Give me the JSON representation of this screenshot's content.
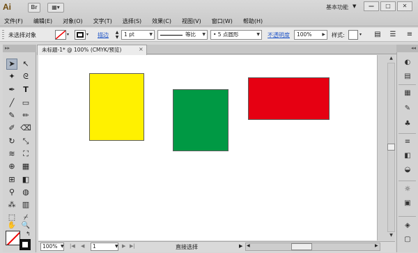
{
  "app": {
    "logo": "Ai",
    "bridge": "Br"
  },
  "workspace": "基本功能",
  "window_buttons": {
    "minimize": "—",
    "maximize": "□",
    "close": "✕"
  },
  "menu": [
    "文件(F)",
    "编辑(E)",
    "对象(O)",
    "文字(T)",
    "选择(S)",
    "效果(C)",
    "视图(V)",
    "窗口(W)",
    "帮助(H)"
  ],
  "control_bar": {
    "selection_status": "未选择对象",
    "stroke_link": "描边",
    "stroke_weight": "1 pt",
    "stroke_profile": "等比",
    "brush": "• 5 点圆形",
    "opacity_link": "不透明度",
    "opacity_value": "100%",
    "style_label": "样式:"
  },
  "document": {
    "tab_title": "未标题-1* @ 100% (CMYK/预览)",
    "tab_close": "×"
  },
  "artwork": [
    {
      "name": "yellow-rect",
      "color": "#FFF100"
    },
    {
      "name": "green-rect",
      "color": "#009944"
    },
    {
      "name": "red-rect",
      "color": "#E60012"
    }
  ],
  "status_bar": {
    "zoom": "100%",
    "page": "1",
    "tool_status": "直接选择"
  },
  "colors": {
    "fill": "none",
    "stroke": "#000000",
    "accent_link": "#2156c8"
  },
  "tools": [
    "selection-tool-icon",
    "direct-selection-tool-icon",
    "magic-wand-tool-icon",
    "lasso-tool-icon",
    "pen-tool-icon",
    "type-tool-icon",
    "line-segment-tool-icon",
    "rectangle-tool-icon",
    "paintbrush-tool-icon",
    "pencil-tool-icon",
    "blob-brush-tool-icon",
    "eraser-tool-icon",
    "rotate-tool-icon",
    "scale-tool-icon",
    "width-tool-icon",
    "free-transform-tool-icon",
    "shape-builder-tool-icon",
    "perspective-grid-tool-icon",
    "mesh-tool-icon",
    "gradient-tool-icon",
    "eyedropper-tool-icon",
    "blend-tool-icon",
    "symbol-sprayer-tool-icon",
    "column-graph-tool-icon",
    "artboard-tool-icon",
    "slice-tool-icon",
    "hand-tool-icon",
    "zoom-tool-icon"
  ],
  "dock_panels": [
    "color-panel-icon",
    "color-guide-panel-icon",
    "swatches-panel-icon",
    "brushes-panel-icon",
    "symbols-panel-icon",
    "stroke-panel-icon",
    "gradient-panel-icon",
    "transparency-panel-icon",
    "appearance-panel-icon",
    "graphic-styles-panel-icon",
    "layers-panel-icon",
    "artboards-panel-icon"
  ]
}
